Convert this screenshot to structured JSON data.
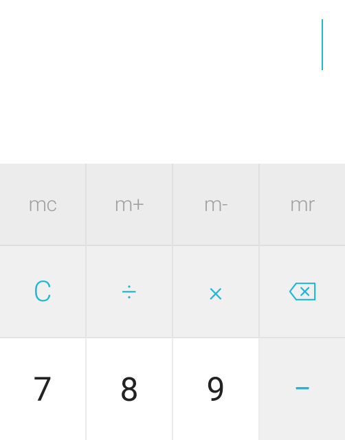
{
  "display": {
    "value": ""
  },
  "colors": {
    "accent": "#1eb8d6",
    "muted": "#a0a0a0",
    "digit": "#222"
  },
  "memory": {
    "mc": "mc",
    "mplus": "m+",
    "mminus": "m-",
    "mr": "mr"
  },
  "ops": {
    "clear": "C",
    "divide": "÷",
    "multiply": "×",
    "backspace_icon": "backspace-icon"
  },
  "digits": {
    "seven": "7",
    "eight": "8",
    "nine": "9"
  },
  "side_ops": {
    "minus": "−"
  }
}
